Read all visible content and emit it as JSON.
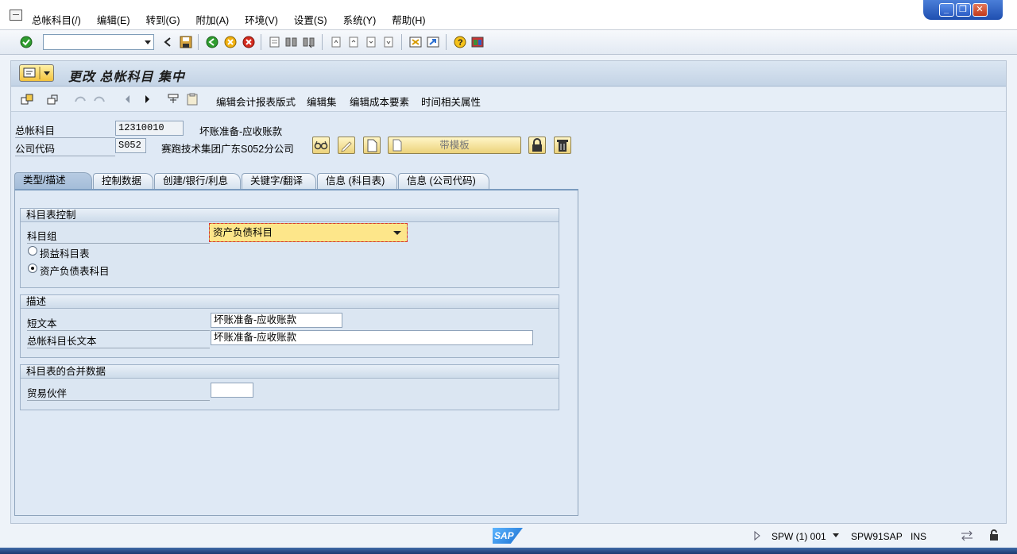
{
  "menu": {
    "items": [
      "总帐科目(/)",
      "编辑(E)",
      "转到(G)",
      "附加(A)",
      "环境(V)",
      "设置(S)",
      "系统(Y)",
      "帮助(H)"
    ]
  },
  "window_controls": {
    "minimize": "_",
    "restore": "❐",
    "close": "✕"
  },
  "toolbar": {
    "command_field_value": ""
  },
  "title": "更改 总帐科目 集中",
  "app_toolbar": {
    "btn_report_layout": "编辑会计报表版式",
    "btn_edit_set": "编辑集",
    "btn_cost_element": "编辑成本要素",
    "btn_time_attr": "时间相关属性"
  },
  "header": {
    "gl_account_label": "总帐科目",
    "gl_account_value": "12310010",
    "gl_account_desc": "坏账准备-应收账款",
    "company_code_label": "公司代码",
    "company_code_value": "S052",
    "company_code_desc": "赛跑技术集团广东S052分公司",
    "template_button": "带模板"
  },
  "tabs": [
    {
      "label": "类型/描述",
      "active": true
    },
    {
      "label": "控制数据",
      "active": false
    },
    {
      "label": "创建/银行/利息",
      "active": false
    },
    {
      "label": "关键字/翻译",
      "active": false
    },
    {
      "label": "信息 (科目表)",
      "active": false
    },
    {
      "label": "信息 (公司代码)",
      "active": false
    }
  ],
  "group_coa_control": {
    "title": "科目表控制",
    "account_group_label": "科目组",
    "account_group_value": "资产负债科目",
    "radio_pl": "损益科目表",
    "radio_bs": "资产负债表科目",
    "selected": "radio_bs"
  },
  "group_description": {
    "title": "描述",
    "short_text_label": "短文本",
    "short_text_value": "坏账准备-应收账款",
    "long_text_label": "总帐科目长文本",
    "long_text_value": "坏账准备-应收账款"
  },
  "group_consolidation": {
    "title": "科目表的合并数据",
    "trading_partner_label": "贸易伙伴",
    "trading_partner_value": ""
  },
  "status": {
    "system": "SPW (1) 001",
    "server": "SPW91SAP",
    "mode": "INS",
    "logo": "SAP"
  },
  "colors": {
    "accent": "#f3c23d",
    "panel": "#dfe9f5",
    "dropdown_focus": "#fde68a"
  }
}
